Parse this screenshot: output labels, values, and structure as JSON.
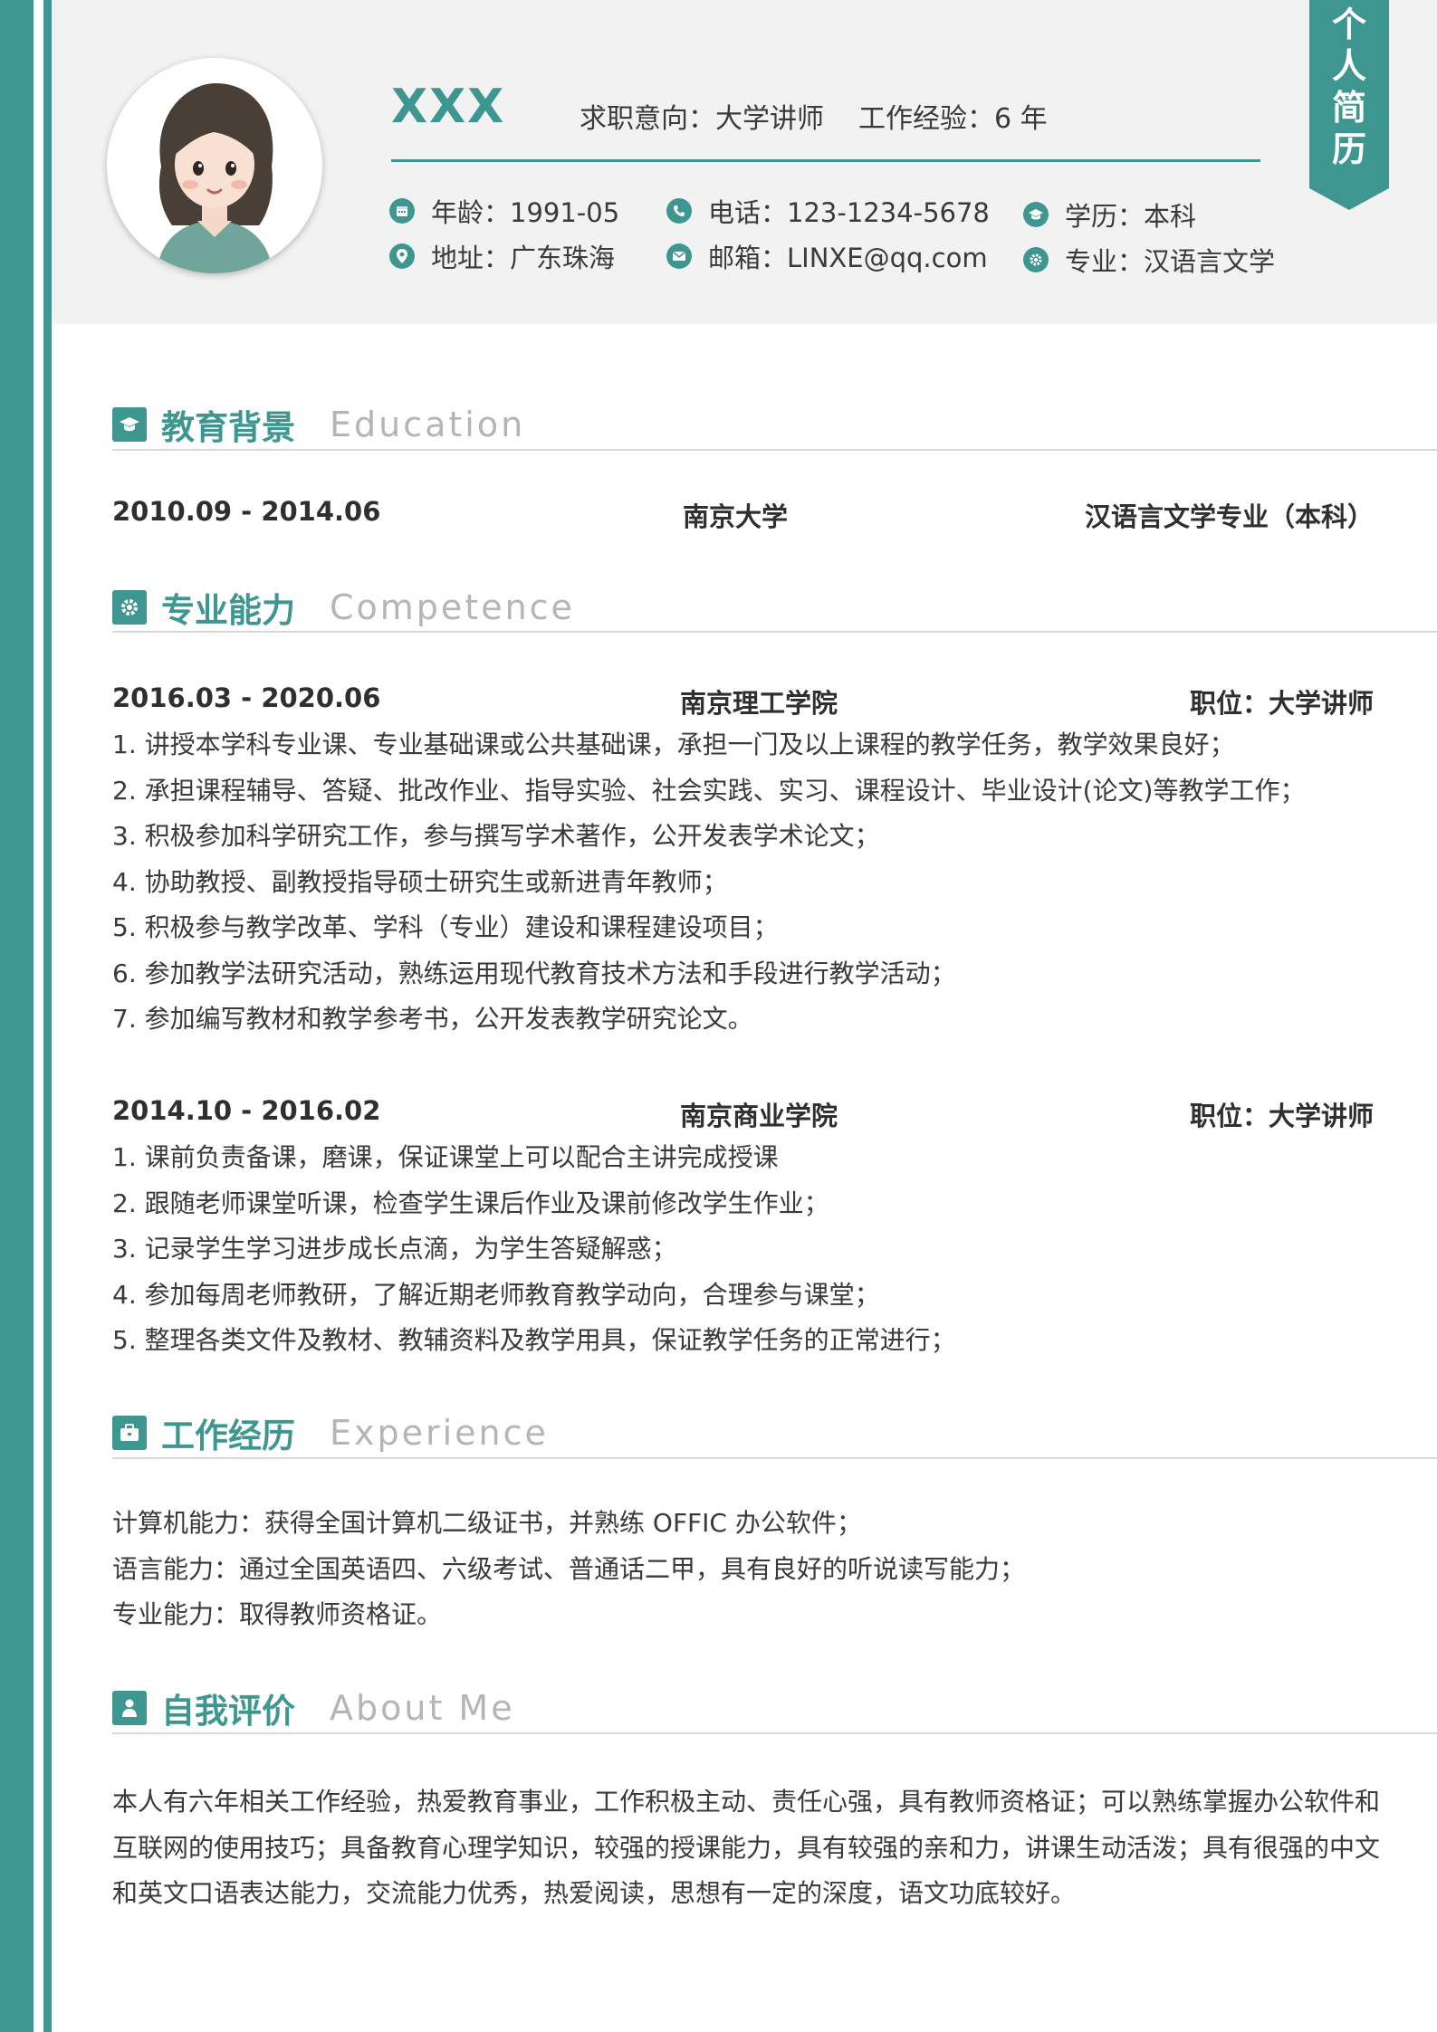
{
  "header": {
    "name": "XXX",
    "intent": "求职意向：大学讲师",
    "experience": "工作经验：6 年",
    "ribbon": "个人简历",
    "info": [
      {
        "icon": "calendar-icon",
        "text": "年龄：1991-05"
      },
      {
        "icon": "location-pin-icon",
        "text": "地址：广东珠海"
      },
      {
        "icon": "phone-icon",
        "text": "电话：123-1234-5678"
      },
      {
        "icon": "envelope-icon",
        "text": "邮箱：LINXE@qq.com"
      },
      {
        "icon": "graduation-cap-icon",
        "text": "学历：本科"
      },
      {
        "icon": "gear-icon",
        "text": "专业：汉语言文学"
      }
    ]
  },
  "education": {
    "title_cn": "教育背景",
    "title_en": "Education",
    "period": "2010.09 - 2014.06",
    "school": "南京大学",
    "major": "汉语言文学专业（本科）"
  },
  "competence": {
    "title_cn": "专业能力",
    "title_en": "Competence",
    "jobs": [
      {
        "period": "2016.03 - 2020.06",
        "org": "南京理工学院",
        "position": "职位：大学讲师",
        "items": [
          "1. 讲授本学科专业课、专业基础课或公共基础课，承担一门及以上课程的教学任务，教学效果良好；",
          "2. 承担课程辅导、答疑、批改作业、指导实验、社会实践、实习、课程设计、毕业设计(论文)等教学工作；",
          "3. 积极参加科学研究工作，参与撰写学术著作，公开发表学术论文；",
          "4. 协助教授、副教授指导硕士研究生或新进青年教师；",
          "5. 积极参与教学改革、学科（专业）建设和课程建设项目；",
          "6. 参加教学法研究活动，熟练运用现代教育技术方法和手段进行教学活动；",
          "7. 参加编写教材和教学参考书，公开发表教学研究论文。"
        ]
      },
      {
        "period": "2014.10 - 2016.02",
        "org": "南京商业学院",
        "position": "职位：大学讲师",
        "items": [
          "1. 课前负责备课，磨课，保证课堂上可以配合主讲完成授课",
          "2. 跟随老师课堂听课，检查学生课后作业及课前修改学生作业；",
          "3. 记录学生学习进步成长点滴，为学生答疑解惑；",
          "4. 参加每周老师教研，了解近期老师教育教学动向，合理参与课堂；",
          "5. 整理各类文件及教材、教辅资料及教学用具，保证教学任务的正常进行；"
        ]
      }
    ]
  },
  "experience": {
    "title_cn": "工作经历",
    "title_en": "Experience",
    "lines": [
      "计算机能力：获得全国计算机二级证书，并熟练 OFFIC 办公软件；",
      "语言能力：通过全国英语四、六级考试、普通话二甲，具有良好的听说读写能力；",
      "专业能力：取得教师资格证。"
    ]
  },
  "about": {
    "title_cn": "自我评价",
    "title_en": "About Me",
    "text": "本人有六年相关工作经验，热爱教育事业，工作积极主动、责任心强，具有教师资格证；可以熟练掌握办公软件和互联网的使用技巧；具备教育心理学知识，较强的授课能力，具有较强的亲和力，讲课生动活泼；具有很强的中文和英文口语表达能力，交流能力优秀，热爱阅读，思想有一定的深度，语文功底较好。"
  },
  "colors": {
    "accent": "#3e9690",
    "header_bg": "#f2f2f2",
    "muted": "#b5b5b5"
  }
}
